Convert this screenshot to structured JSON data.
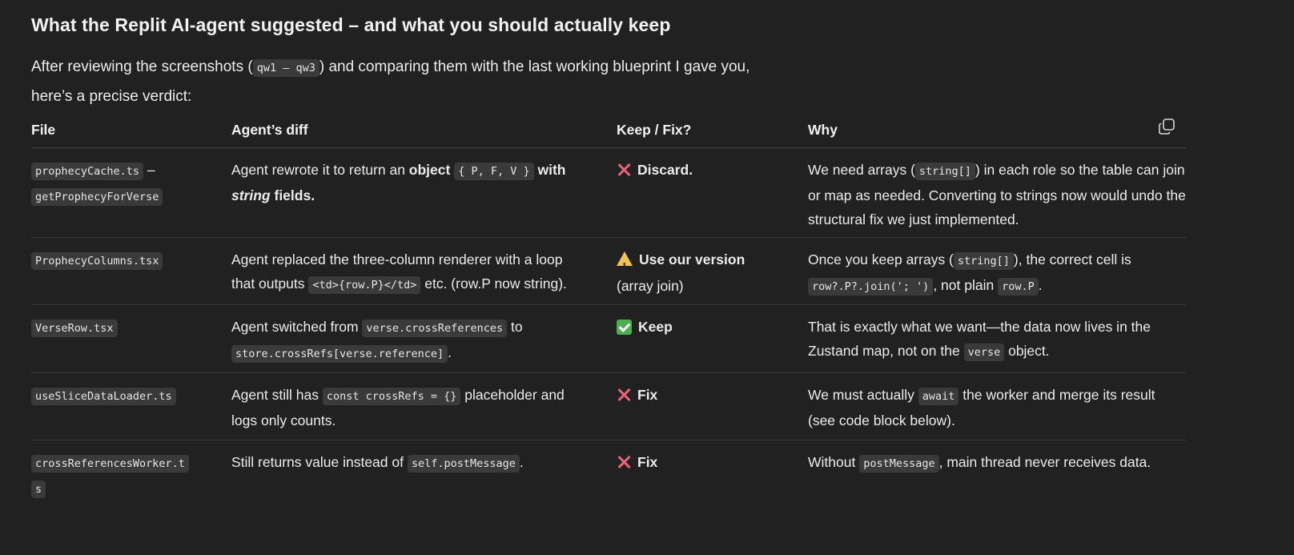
{
  "heading": "What the Replit AI-agent suggested – and what you should actually keep",
  "intro": {
    "before": "After reviewing the screenshots (",
    "code": "qw1 – qw3",
    "after": ") and comparing them with the last working blueprint I gave you,",
    "line2": "here’s a precise verdict:"
  },
  "table": {
    "headers": {
      "file": "File",
      "diff": "Agent’s diff",
      "keep": "Keep / Fix?",
      "why": "Why"
    },
    "copy_icon": "copy-icon",
    "rows": [
      {
        "file_code1": "prophecyCache.ts",
        "file_dash": " – ",
        "file_code2": "getProphecyForVerse",
        "diff_t1": "Agent rewrote it to return an ",
        "diff_b1": "object",
        "diff_code1": "{ P, F, V }",
        "diff_b2": "with",
        "diff_i1": "string",
        "diff_b3": " fields.",
        "verdict_icon": "cross-icon",
        "verdict": "Discard.",
        "why_t1": "We need arrays (",
        "why_code1": "string[]",
        "why_t2": ") in each role so the table can join or map as needed. Converting to strings now would undo the structural fix we just implemented."
      },
      {
        "file_code1": "ProphecyColumns.tsx",
        "diff_t1": "Agent replaced the three-column renderer with a loop that outputs ",
        "diff_code1": "<td>{row.P}</td>",
        "diff_t2": " etc. (row.P now string).",
        "verdict_icon": "warning-icon",
        "verdict": "Use our version",
        "verdict_sub": "(array join)",
        "why_t1": "Once you keep arrays (",
        "why_code1": "string[]",
        "why_t2": "), the correct cell is",
        "why_code2": "row?.P?.join('; ')",
        "why_t3": ", not plain ",
        "why_code3": "row.P",
        "why_t4": "."
      },
      {
        "file_code1": "VerseRow.tsx",
        "diff_t1": "Agent switched from ",
        "diff_code1": "verse.crossReferences",
        "diff_t2": " to",
        "diff_code2": "store.crossRefs[verse.reference]",
        "diff_t3": ".",
        "verdict_icon": "check-icon",
        "verdict": "Keep",
        "why_t1": "That is exactly what we want—the data now lives in the Zustand map, not on the ",
        "why_code1": "verse",
        "why_t2": " object."
      },
      {
        "file_code1": "useSliceDataLoader.ts",
        "diff_t1": "Agent still has ",
        "diff_code1": "const crossRefs = {}",
        "diff_t2": " placeholder and logs only counts.",
        "verdict_icon": "cross-icon",
        "verdict": "Fix",
        "why_t1": "We must actually ",
        "why_code1": "await",
        "why_t2": " the worker and merge its result (see code block below)."
      },
      {
        "file_code1": "crossReferencesWorker.t",
        "file_code2": "s",
        "diff_t1": "Still returns value instead of ",
        "diff_code1": "self.postMessage",
        "diff_t2": ".",
        "verdict_icon": "cross-icon",
        "verdict": "Fix",
        "why_t1": "Without ",
        "why_code1": "postMessage",
        "why_t2": ", main thread never receives data."
      }
    ]
  }
}
